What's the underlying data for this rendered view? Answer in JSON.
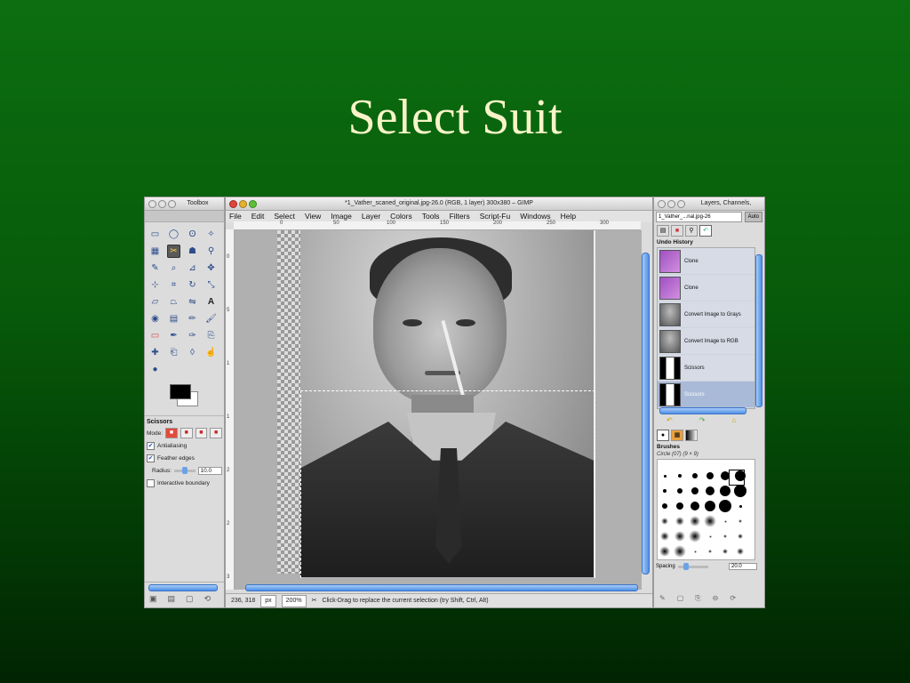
{
  "slide": {
    "title": "Select Suit"
  },
  "toolbox": {
    "title": "Toolbox",
    "options": {
      "tool_name": "Scissors",
      "mode_label": "Mode:",
      "antialiasing": "Antialiasing",
      "feather_edges": "Feather edges",
      "radius_label": "Radius:",
      "radius_value": "10.0",
      "interactive_boundary": "Interactive boundary"
    }
  },
  "image_window": {
    "title": "*1_Vather_scaned_original.jpg-26.0 (RGB, 1 layer) 300x380 – GIMP",
    "menu": [
      "File",
      "Edit",
      "Select",
      "View",
      "Image",
      "Layer",
      "Colors",
      "Tools",
      "Filters",
      "Script-Fu",
      "Windows",
      "Help"
    ],
    "ruler_top": [
      "0",
      "50",
      "100",
      "150",
      "200",
      "250",
      "300"
    ],
    "ruler_left": [
      "0",
      "5",
      "1",
      "1",
      "2",
      "2",
      "3"
    ],
    "status": {
      "coords": "236, 318",
      "unit": "px",
      "zoom": "200%",
      "message": "Click-Drag to replace the current selection (try Shift, Ctrl, Alt)"
    }
  },
  "dock": {
    "title": "Layers, Channels,",
    "image_combo": "1_Vather_...nal.jpg-26",
    "auto_label": "Auto",
    "undo_history_title": "Undo History",
    "history": [
      {
        "label": "Clone",
        "thumb": "clone"
      },
      {
        "label": "Clone",
        "thumb": "clone"
      },
      {
        "label": "Convert Image to Grays",
        "thumb": "gray"
      },
      {
        "label": "Convert Image to RGB",
        "thumb": "gray"
      },
      {
        "label": "Scissors",
        "thumb": "black"
      },
      {
        "label": "Scissors",
        "thumb": "black"
      }
    ],
    "brushes_title": "Brushes",
    "brush_name": "Circle (07) (9 × 9)",
    "spacing_label": "Spacing",
    "spacing_value": "20.0"
  }
}
